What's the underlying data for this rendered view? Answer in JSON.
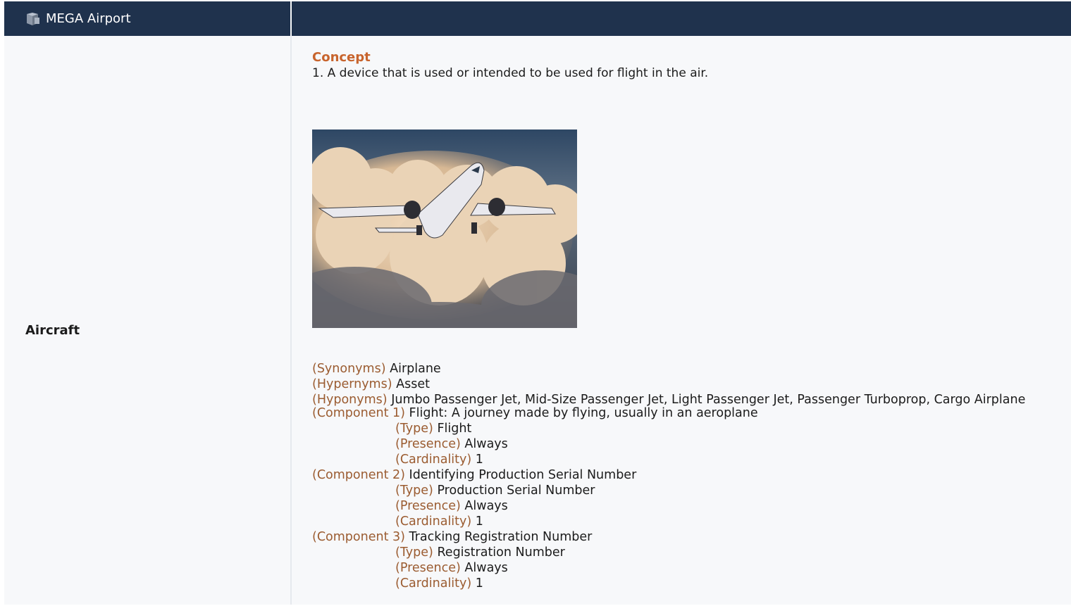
{
  "header": {
    "app_title": "MEGA Airport",
    "icon": "cube-icon",
    "bg_color": "#1f324d"
  },
  "entry": {
    "term": "Aircraft",
    "concept_heading": "Concept",
    "definition": "1. A device that is used or intended to be used for flight in the air.",
    "image_subject": "airplane-photo",
    "relations": {
      "synonyms_label": "(Synonyms)",
      "synonyms": "Airplane",
      "hypernyms_label": "(Hypernyms)",
      "hypernyms": "Asset",
      "hyponyms_label": "(Hyponyms)",
      "hyponyms": "Jumbo Passenger Jet, Mid-Size Passenger Jet, Light Passenger Jet, Passenger Turboprop, Cargo Airplane"
    },
    "components": [
      {
        "label": "(Component 1)",
        "value": "Flight: A journey made by flying, usually in an aeroplane",
        "type_label": "(Type)",
        "type": "Flight",
        "presence_label": "(Presence)",
        "presence": "Always",
        "cardinality_label": "(Cardinality)",
        "cardinality": "1"
      },
      {
        "label": "(Component 2)",
        "value": "Identifying Production Serial Number",
        "type_label": "(Type)",
        "type": "Production Serial Number",
        "presence_label": "(Presence)",
        "presence": "Always",
        "cardinality_label": "(Cardinality)",
        "cardinality": "1"
      },
      {
        "label": "(Component 3)",
        "value": "Tracking Registration Number",
        "type_label": "(Type)",
        "type": "Registration Number",
        "presence_label": "(Presence)",
        "presence": "Always",
        "cardinality_label": "(Cardinality)",
        "cardinality": "1"
      }
    ],
    "colors": {
      "heading": "#c8642d",
      "label": "#9b5c31"
    }
  }
}
